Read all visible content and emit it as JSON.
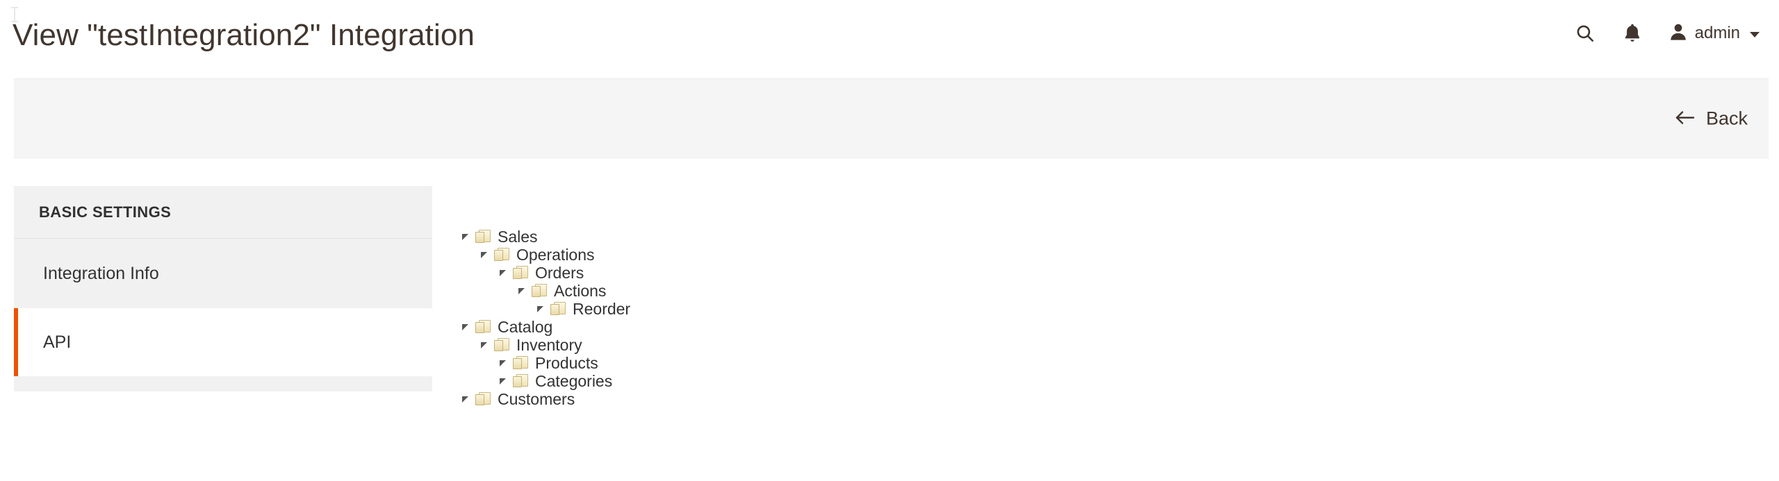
{
  "header": {
    "title": "View \"testIntegration2\" Integration",
    "search_icon": "search-icon",
    "notifications_icon": "bell-icon",
    "avatar_icon": "user-avatar-icon",
    "user_name": "admin",
    "dropdown_icon": "chevron-down-icon"
  },
  "page_actions": {
    "back_label": "Back",
    "back_icon": "arrow-left-icon"
  },
  "sidebar": {
    "title": "BASIC SETTINGS",
    "items": [
      {
        "label": "Integration Info",
        "active": false
      },
      {
        "label": "API",
        "active": true
      }
    ]
  },
  "tree": {
    "collapse_icon": "triangle-collapse-icon",
    "node_icon": "folder-icon",
    "nodes": [
      {
        "label": "Sales",
        "depth": 0
      },
      {
        "label": "Operations",
        "depth": 1
      },
      {
        "label": "Orders",
        "depth": 2
      },
      {
        "label": "Actions",
        "depth": 3
      },
      {
        "label": "Reorder",
        "depth": 4
      },
      {
        "label": "Catalog",
        "depth": 0
      },
      {
        "label": "Inventory",
        "depth": 1
      },
      {
        "label": "Products",
        "depth": 2
      },
      {
        "label": "Categories",
        "depth": 2
      },
      {
        "label": "Customers",
        "depth": 0
      }
    ]
  },
  "colors": {
    "accent": "#eb5202",
    "header_text": "#41362f",
    "panel_bg": "#f1f1f1",
    "actions_bg": "#f5f5f5"
  }
}
